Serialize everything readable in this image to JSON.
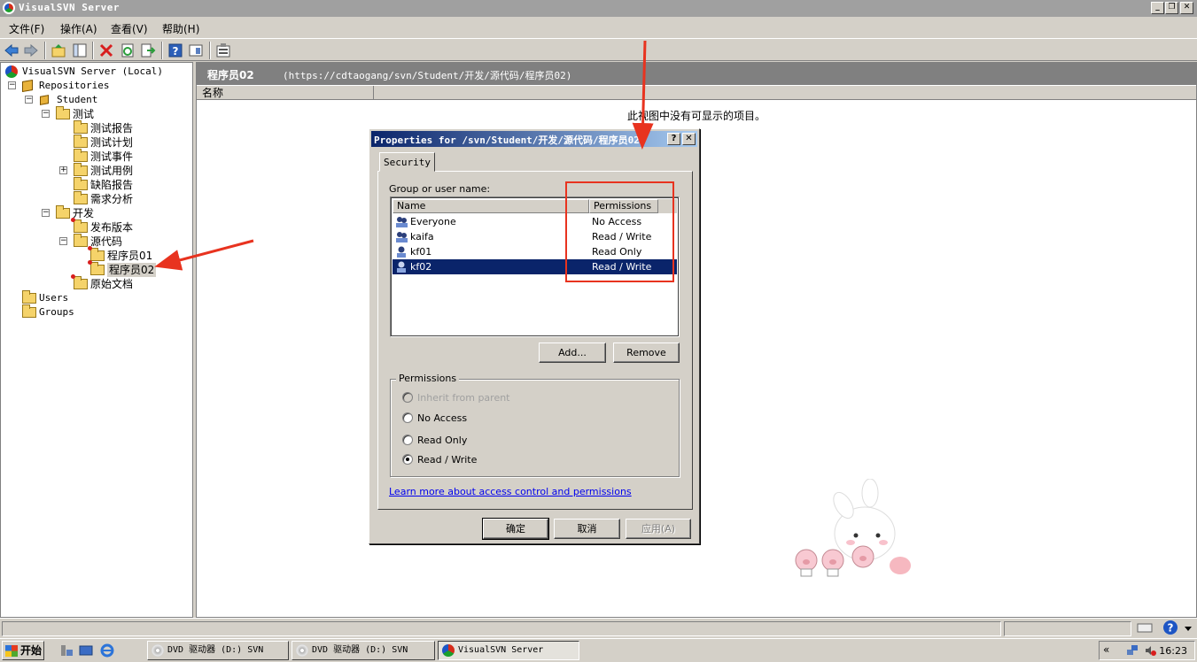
{
  "window": {
    "title": "VisualSVN Server",
    "min": "_",
    "restore": "❐",
    "close": "✕"
  },
  "menu": [
    "文件(F)",
    "操作(A)",
    "查看(V)",
    "帮助(H)"
  ],
  "tree": {
    "root": "VisualSVN Server (Local)",
    "repositories": "Repositories",
    "student": "Student",
    "ceshi": "测试",
    "ceshi_baogao": "测试报告",
    "ceshi_jihua": "测试计划",
    "ceshi_shijian": "测试事件",
    "ceshi_yongli": "测试用例",
    "quexian_baogao": "缺陷报告",
    "xuqiu_fenxi": "需求分析",
    "kaifa": "开发",
    "fabu_banben": "发布版本",
    "yuandaima": "源代码",
    "chengxuyuan01": "程序员01",
    "chengxuyuan02": "程序员02",
    "yuanshi_wendang": "原始文档",
    "users": "Users",
    "groups": "Groups"
  },
  "rightpane": {
    "title": "程序员02",
    "url": "(https://cdtaogang/svn/Student/开发/源代码/程序员02)",
    "column_name": "名称",
    "empty_message": "此视图中没有可显示的项目。"
  },
  "dialog": {
    "title": "Properties for /svn/Student/开发/源代码/程序员02",
    "help": "?",
    "close": "✕",
    "tab": "Security",
    "group_label": "Group or user name:",
    "col_name": "Name",
    "col_permissions": "Permissions",
    "entries": [
      {
        "name": "Everyone",
        "permission": "No Access"
      },
      {
        "name": "kaifa",
        "permission": "Read / Write"
      },
      {
        "name": "kf01",
        "permission": "Read Only"
      },
      {
        "name": "kf02",
        "permission": "Read / Write"
      }
    ],
    "add_button": "Add...",
    "remove_button": "Remove",
    "permissions_group": "Permissions",
    "radio_inherit": "Inherit from parent",
    "radio_no_access": "No Access",
    "radio_read_only": "Read Only",
    "radio_read_write": "Read / Write",
    "learn_more": "Learn more about access control and permissions",
    "ok_button": "确定",
    "cancel_button": "取消",
    "apply_button": "应用(A)"
  },
  "taskbar": {
    "start": "开始",
    "tasks": [
      "DVD 驱动器 (D:) SVN",
      "DVD 驱动器 (D:) SVN",
      "VisualSVN Server"
    ],
    "tray_chevron": "«",
    "clock": "16:23"
  },
  "colors": {
    "selection": "#0a246a",
    "annotation_red": "#e8331f",
    "link": "#0000ee"
  }
}
